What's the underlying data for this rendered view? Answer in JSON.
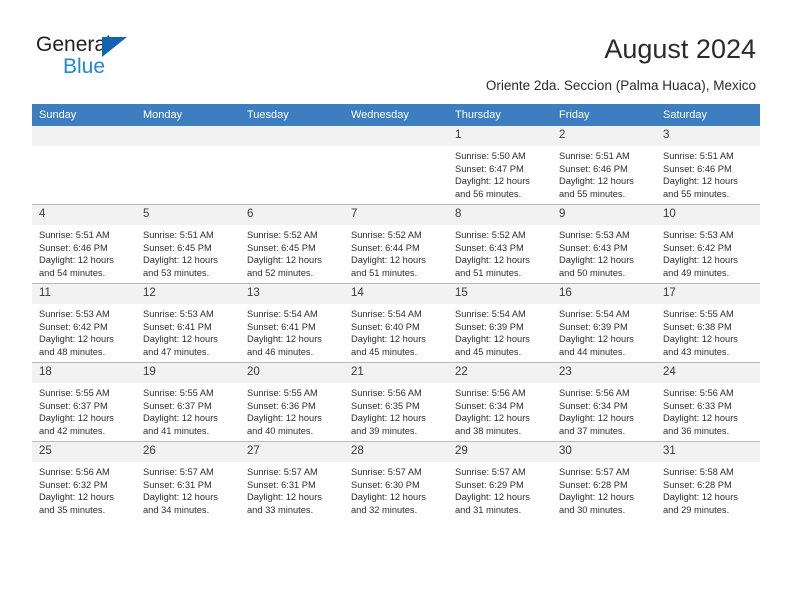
{
  "brand": {
    "name_top": "General",
    "name_bottom": "Blue",
    "triangle_color": "#1263b0",
    "blue_color": "#1c8ad6"
  },
  "header": {
    "title": "August 2024",
    "subtitle": "Oriente 2da. Seccion (Palma Huaca), Mexico"
  },
  "theme": {
    "header_bar": "#3c7ebf",
    "daynum_band": "#f2f2f2",
    "row_divider": "#b9b9b9"
  },
  "weekdays": [
    "Sunday",
    "Monday",
    "Tuesday",
    "Wednesday",
    "Thursday",
    "Friday",
    "Saturday"
  ],
  "calendar": {
    "month": "August",
    "year": "2024",
    "weeks": [
      [
        {
          "day": "",
          "empty": true
        },
        {
          "day": "",
          "empty": true
        },
        {
          "day": "",
          "empty": true
        },
        {
          "day": "",
          "empty": true
        },
        {
          "day": "1",
          "sunrise": "Sunrise: 5:50 AM",
          "sunset": "Sunset: 6:47 PM",
          "daylight1": "Daylight: 12 hours",
          "daylight2": "and 56 minutes."
        },
        {
          "day": "2",
          "sunrise": "Sunrise: 5:51 AM",
          "sunset": "Sunset: 6:46 PM",
          "daylight1": "Daylight: 12 hours",
          "daylight2": "and 55 minutes."
        },
        {
          "day": "3",
          "sunrise": "Sunrise: 5:51 AM",
          "sunset": "Sunset: 6:46 PM",
          "daylight1": "Daylight: 12 hours",
          "daylight2": "and 55 minutes."
        }
      ],
      [
        {
          "day": "4",
          "sunrise": "Sunrise: 5:51 AM",
          "sunset": "Sunset: 6:46 PM",
          "daylight1": "Daylight: 12 hours",
          "daylight2": "and 54 minutes."
        },
        {
          "day": "5",
          "sunrise": "Sunrise: 5:51 AM",
          "sunset": "Sunset: 6:45 PM",
          "daylight1": "Daylight: 12 hours",
          "daylight2": "and 53 minutes."
        },
        {
          "day": "6",
          "sunrise": "Sunrise: 5:52 AM",
          "sunset": "Sunset: 6:45 PM",
          "daylight1": "Daylight: 12 hours",
          "daylight2": "and 52 minutes."
        },
        {
          "day": "7",
          "sunrise": "Sunrise: 5:52 AM",
          "sunset": "Sunset: 6:44 PM",
          "daylight1": "Daylight: 12 hours",
          "daylight2": "and 51 minutes."
        },
        {
          "day": "8",
          "sunrise": "Sunrise: 5:52 AM",
          "sunset": "Sunset: 6:43 PM",
          "daylight1": "Daylight: 12 hours",
          "daylight2": "and 51 minutes."
        },
        {
          "day": "9",
          "sunrise": "Sunrise: 5:53 AM",
          "sunset": "Sunset: 6:43 PM",
          "daylight1": "Daylight: 12 hours",
          "daylight2": "and 50 minutes."
        },
        {
          "day": "10",
          "sunrise": "Sunrise: 5:53 AM",
          "sunset": "Sunset: 6:42 PM",
          "daylight1": "Daylight: 12 hours",
          "daylight2": "and 49 minutes."
        }
      ],
      [
        {
          "day": "11",
          "sunrise": "Sunrise: 5:53 AM",
          "sunset": "Sunset: 6:42 PM",
          "daylight1": "Daylight: 12 hours",
          "daylight2": "and 48 minutes."
        },
        {
          "day": "12",
          "sunrise": "Sunrise: 5:53 AM",
          "sunset": "Sunset: 6:41 PM",
          "daylight1": "Daylight: 12 hours",
          "daylight2": "and 47 minutes."
        },
        {
          "day": "13",
          "sunrise": "Sunrise: 5:54 AM",
          "sunset": "Sunset: 6:41 PM",
          "daylight1": "Daylight: 12 hours",
          "daylight2": "and 46 minutes."
        },
        {
          "day": "14",
          "sunrise": "Sunrise: 5:54 AM",
          "sunset": "Sunset: 6:40 PM",
          "daylight1": "Daylight: 12 hours",
          "daylight2": "and 45 minutes."
        },
        {
          "day": "15",
          "sunrise": "Sunrise: 5:54 AM",
          "sunset": "Sunset: 6:39 PM",
          "daylight1": "Daylight: 12 hours",
          "daylight2": "and 45 minutes."
        },
        {
          "day": "16",
          "sunrise": "Sunrise: 5:54 AM",
          "sunset": "Sunset: 6:39 PM",
          "daylight1": "Daylight: 12 hours",
          "daylight2": "and 44 minutes."
        },
        {
          "day": "17",
          "sunrise": "Sunrise: 5:55 AM",
          "sunset": "Sunset: 6:38 PM",
          "daylight1": "Daylight: 12 hours",
          "daylight2": "and 43 minutes."
        }
      ],
      [
        {
          "day": "18",
          "sunrise": "Sunrise: 5:55 AM",
          "sunset": "Sunset: 6:37 PM",
          "daylight1": "Daylight: 12 hours",
          "daylight2": "and 42 minutes."
        },
        {
          "day": "19",
          "sunrise": "Sunrise: 5:55 AM",
          "sunset": "Sunset: 6:37 PM",
          "daylight1": "Daylight: 12 hours",
          "daylight2": "and 41 minutes."
        },
        {
          "day": "20",
          "sunrise": "Sunrise: 5:55 AM",
          "sunset": "Sunset: 6:36 PM",
          "daylight1": "Daylight: 12 hours",
          "daylight2": "and 40 minutes."
        },
        {
          "day": "21",
          "sunrise": "Sunrise: 5:56 AM",
          "sunset": "Sunset: 6:35 PM",
          "daylight1": "Daylight: 12 hours",
          "daylight2": "and 39 minutes."
        },
        {
          "day": "22",
          "sunrise": "Sunrise: 5:56 AM",
          "sunset": "Sunset: 6:34 PM",
          "daylight1": "Daylight: 12 hours",
          "daylight2": "and 38 minutes."
        },
        {
          "day": "23",
          "sunrise": "Sunrise: 5:56 AM",
          "sunset": "Sunset: 6:34 PM",
          "daylight1": "Daylight: 12 hours",
          "daylight2": "and 37 minutes."
        },
        {
          "day": "24",
          "sunrise": "Sunrise: 5:56 AM",
          "sunset": "Sunset: 6:33 PM",
          "daylight1": "Daylight: 12 hours",
          "daylight2": "and 36 minutes."
        }
      ],
      [
        {
          "day": "25",
          "sunrise": "Sunrise: 5:56 AM",
          "sunset": "Sunset: 6:32 PM",
          "daylight1": "Daylight: 12 hours",
          "daylight2": "and 35 minutes."
        },
        {
          "day": "26",
          "sunrise": "Sunrise: 5:57 AM",
          "sunset": "Sunset: 6:31 PM",
          "daylight1": "Daylight: 12 hours",
          "daylight2": "and 34 minutes."
        },
        {
          "day": "27",
          "sunrise": "Sunrise: 5:57 AM",
          "sunset": "Sunset: 6:31 PM",
          "daylight1": "Daylight: 12 hours",
          "daylight2": "and 33 minutes."
        },
        {
          "day": "28",
          "sunrise": "Sunrise: 5:57 AM",
          "sunset": "Sunset: 6:30 PM",
          "daylight1": "Daylight: 12 hours",
          "daylight2": "and 32 minutes."
        },
        {
          "day": "29",
          "sunrise": "Sunrise: 5:57 AM",
          "sunset": "Sunset: 6:29 PM",
          "daylight1": "Daylight: 12 hours",
          "daylight2": "and 31 minutes."
        },
        {
          "day": "30",
          "sunrise": "Sunrise: 5:57 AM",
          "sunset": "Sunset: 6:28 PM",
          "daylight1": "Daylight: 12 hours",
          "daylight2": "and 30 minutes."
        },
        {
          "day": "31",
          "sunrise": "Sunrise: 5:58 AM",
          "sunset": "Sunset: 6:28 PM",
          "daylight1": "Daylight: 12 hours",
          "daylight2": "and 29 minutes."
        }
      ]
    ]
  }
}
